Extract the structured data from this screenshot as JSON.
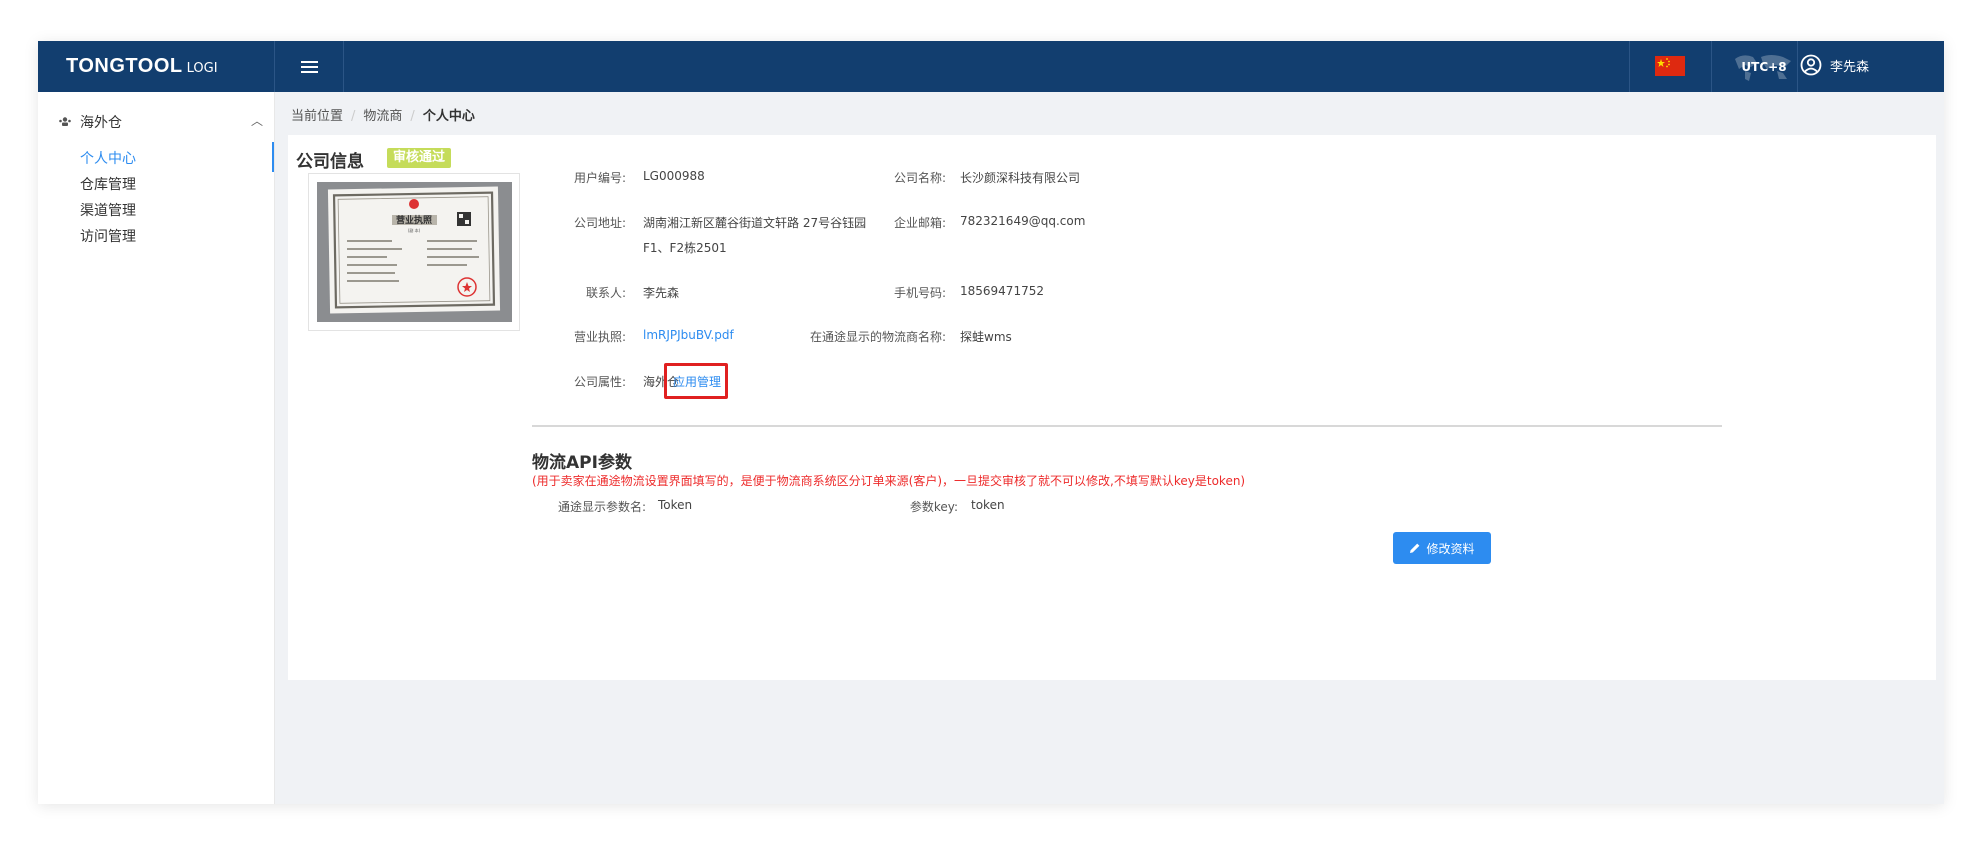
{
  "header": {
    "brand": "TONGTOOL",
    "brand_suffix": "LOGI",
    "timezone": "UTC+8",
    "username": "李先森",
    "flag_color": "#de2910",
    "header_color": "#123e6f"
  },
  "sidebar": {
    "group": "海外仓",
    "items": [
      "个人中心",
      "仓库管理",
      "渠道管理",
      "访问管理"
    ],
    "active_index": 0
  },
  "breadcrumb": [
    "当前位置",
    "物流商",
    "个人中心"
  ],
  "company": {
    "title": "公司信息",
    "status_badge": "审核通过",
    "fields": {
      "user_id_label": "用户编号:",
      "user_id": "LG000988",
      "company_name_label": "公司名称:",
      "company_name": "长沙颜深科技有限公司",
      "address_label": "公司地址:",
      "address_line1": "湖南湘江新区麓谷街道文轩路 27号谷钰园",
      "address_line2": "F1、F2栋2501",
      "email_label": "企业邮箱:",
      "email": "782321649@qq.com",
      "contact_label": "联系人:",
      "contact": "李先森",
      "phone_label": "手机号码:",
      "phone": "18569471752",
      "license_label": "营业执照:",
      "license_file": "lmRJPJbuBV.pdf",
      "display_name_label": "在通途显示的物流商名称:",
      "display_name": "探蛙wms",
      "attr_label": "公司属性:",
      "attr_value": "海外仓",
      "attr_link": "应用管理"
    },
    "license_image": {
      "heading": "营业执照",
      "subheading": "(副 本)"
    }
  },
  "api": {
    "title": "物流API参数",
    "note": "(用于卖家在通途物流设置界面填写的，是便于物流商系统区分订单来源(客户)，一旦提交审核了就不可以修改,不填写默认key是token)",
    "param_name_label": "通途显示参数名:",
    "param_name": "Token",
    "param_key_label": "参数key:",
    "param_key": "token"
  },
  "actions": {
    "edit_label": "修改资料"
  }
}
